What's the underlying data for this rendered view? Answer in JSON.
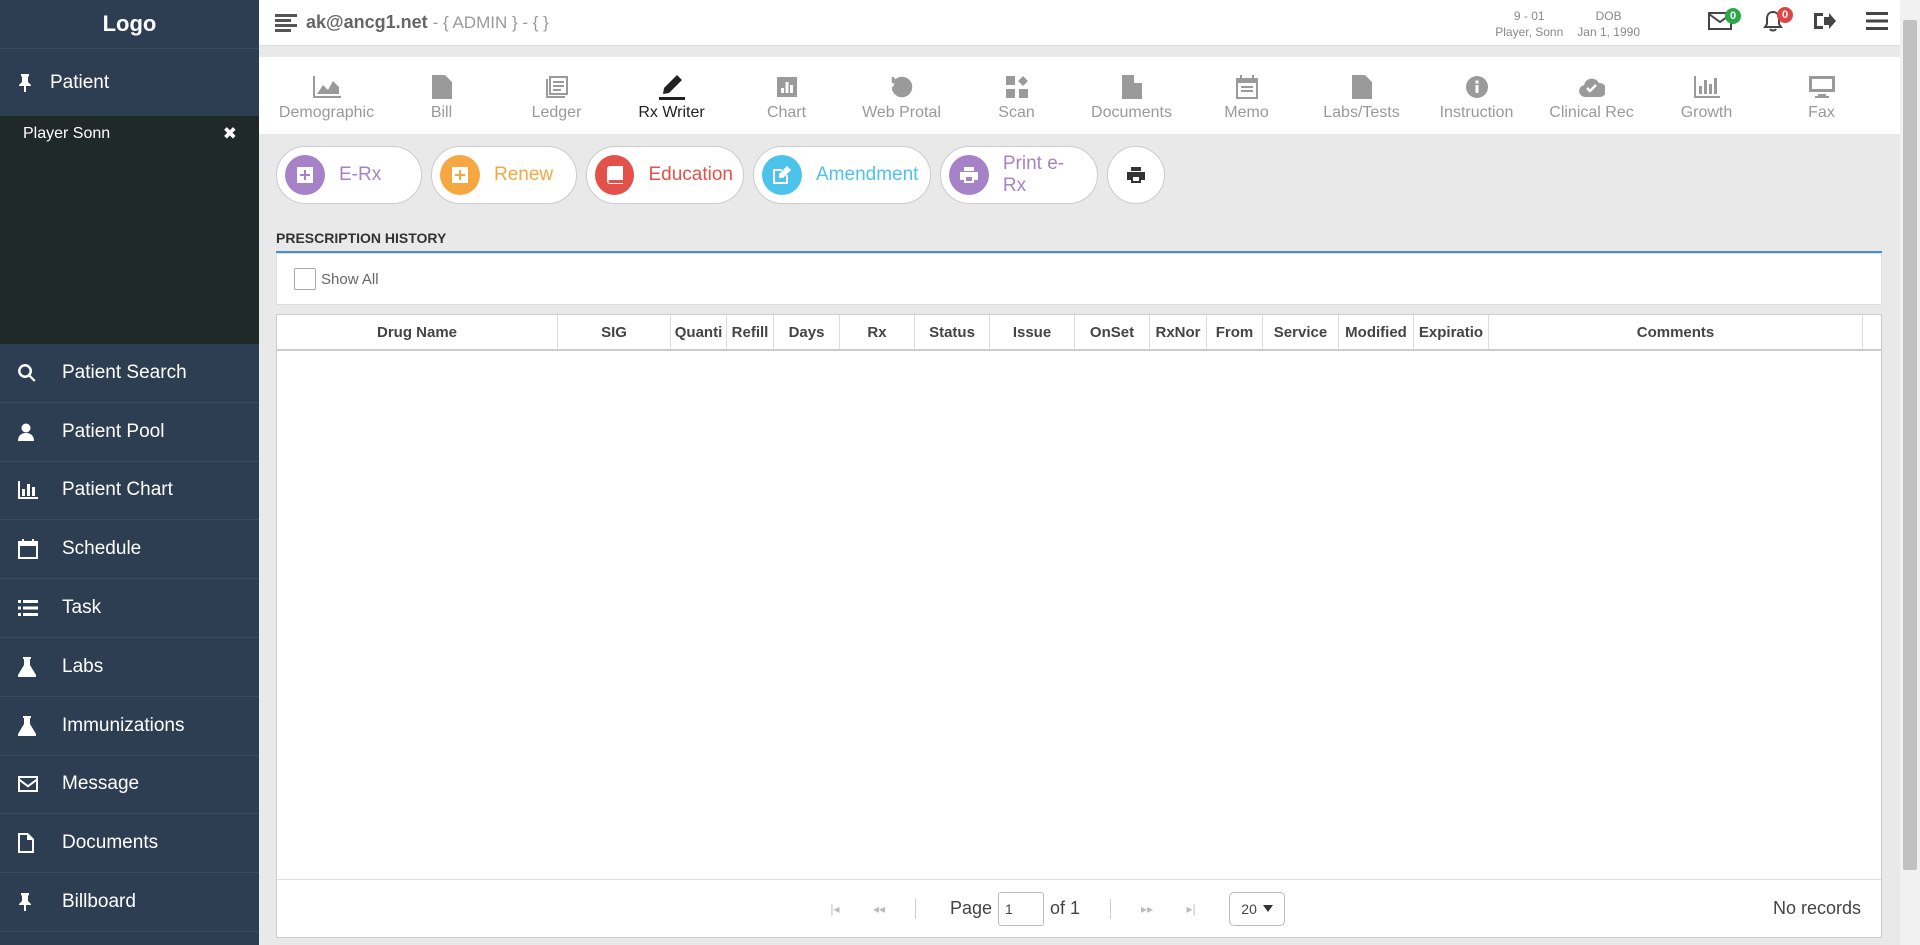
{
  "sidebar": {
    "logo": "Logo",
    "patient_header": "Patient",
    "patient_name": "Player Sonn",
    "close_symbol": "✖",
    "items": [
      {
        "label": "Patient Search",
        "icon": "search-icon"
      },
      {
        "label": "Patient Pool",
        "icon": "person-icon"
      },
      {
        "label": "Patient Chart",
        "icon": "bar-chart-icon"
      },
      {
        "label": "Schedule",
        "icon": "calendar-icon"
      },
      {
        "label": "Task",
        "icon": "list-icon"
      },
      {
        "label": "Labs",
        "icon": "flask-icon"
      },
      {
        "label": "Immunizations",
        "icon": "flask-icon"
      },
      {
        "label": "Message",
        "icon": "envelope-icon"
      },
      {
        "label": "Documents",
        "icon": "document-icon"
      },
      {
        "label": "Billboard",
        "icon": "pin-icon"
      }
    ]
  },
  "topbar": {
    "email": "ak@ancg1.net",
    "role": "- { ADMIN } - { }",
    "patient_id": "9 - 01",
    "patient_short": "Player, Sonn",
    "dob_label": "DOB",
    "dob_value": "Jan 1, 1990",
    "mail_count": "0",
    "alert_count": "0"
  },
  "tabs": [
    {
      "label": "Demographic",
      "icon": "area-chart-icon"
    },
    {
      "label": "Bill",
      "icon": "document-icon"
    },
    {
      "label": "Ledger",
      "icon": "ledger-icon"
    },
    {
      "label": "Rx Writer",
      "icon": "pen-icon",
      "active": true
    },
    {
      "label": "Chart",
      "icon": "bar-chart-icon"
    },
    {
      "label": "Web Protal",
      "icon": "history-icon"
    },
    {
      "label": "Scan",
      "icon": "scan-icon"
    },
    {
      "label": "Documents",
      "icon": "document-icon"
    },
    {
      "label": "Memo",
      "icon": "calendar-icon"
    },
    {
      "label": "Labs/Tests",
      "icon": "document-lines-icon"
    },
    {
      "label": "Instruction",
      "icon": "info-icon"
    },
    {
      "label": "Clinical Rec",
      "icon": "cloud-check-icon"
    },
    {
      "label": "Growth",
      "icon": "bar-chart-icon"
    },
    {
      "label": "Fax",
      "icon": "monitor-icon"
    }
  ],
  "actions": [
    {
      "label": "E-Rx",
      "color": "#a683c9",
      "icon": "plus-icon"
    },
    {
      "label": "Renew",
      "color": "#f5a742",
      "icon": "plus-icon"
    },
    {
      "label": "Education",
      "color": "#e2514a",
      "icon": "book-icon"
    },
    {
      "label": "Amendment",
      "color": "#4cc3eb",
      "icon": "edit-icon"
    },
    {
      "label": "Print e-Rx",
      "color": "#a683c9",
      "icon": "print-icon"
    }
  ],
  "section": {
    "title": "PRESCRIPTION HISTORY",
    "show_all": "Show All"
  },
  "grid": {
    "columns": [
      "Drug Name",
      "SIG",
      "Quanti",
      "Refill",
      "Days",
      "Rx",
      "Status",
      "Issue",
      "OnSet",
      "RxNor",
      "From",
      "Service",
      "Modified",
      "Expiratio",
      "Comments"
    ],
    "pager": {
      "page_label": "Page",
      "page_value": "1",
      "of_label": "of 1",
      "page_size": "20",
      "empty": "No records"
    }
  }
}
